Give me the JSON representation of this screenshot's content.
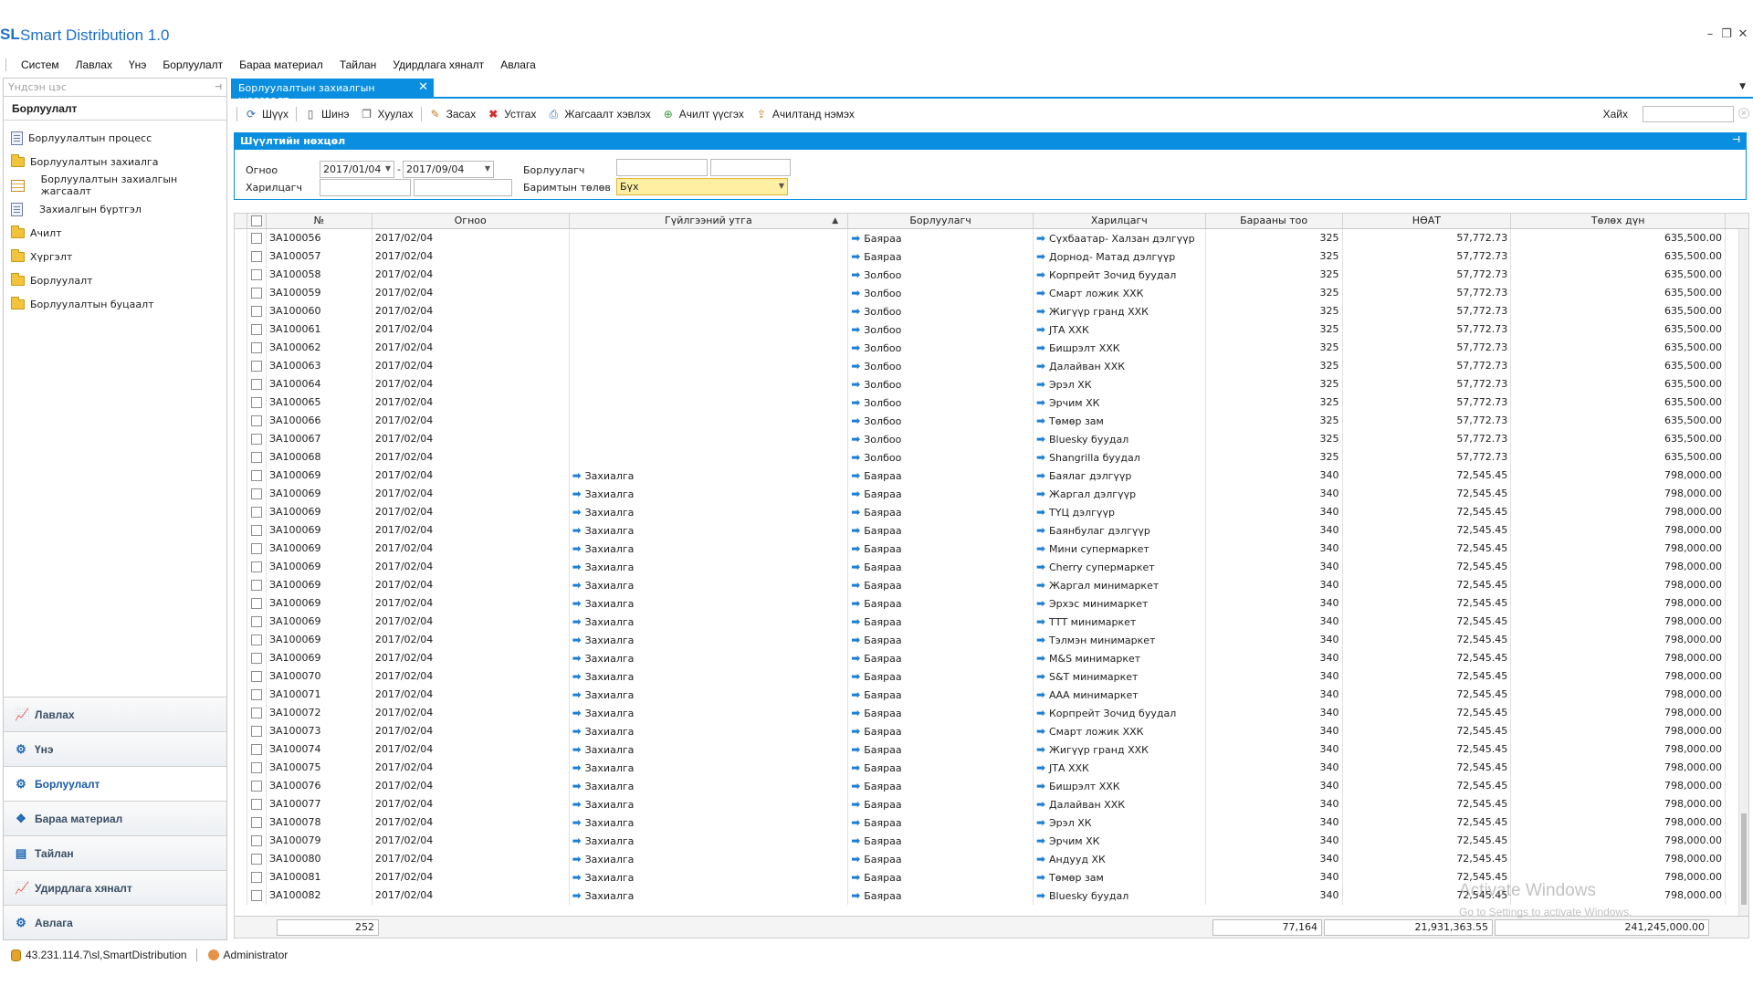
{
  "app": {
    "logo": "SL",
    "title": "Smart Distribution 1.0",
    "window_controls": [
      "–",
      "❐",
      "✕"
    ]
  },
  "menu": [
    "Систем",
    "Лавлах",
    "Үнэ",
    "Борлуулалт",
    "Бараа материал",
    "Тайлан",
    "Удирдлага хяналт",
    "Авлага"
  ],
  "sidebar": {
    "search_placeholder": "Үндсэн цэс",
    "header": "Борлуулалт",
    "tree": [
      {
        "label": "Борлуулалтын процесс",
        "icon": "document-icon"
      },
      {
        "label": "Борлуулалтын захиалга",
        "icon": "folder-icon"
      },
      {
        "label": "Борлуулалтын захиалгын жагсаалт",
        "icon": "grid-icon"
      },
      {
        "label": "Захиалгын бүртгэл",
        "icon": "document-icon"
      },
      {
        "label": "Ачилт",
        "icon": "folder-icon"
      },
      {
        "label": "Хүргэлт",
        "icon": "folder-icon"
      },
      {
        "label": "Борлуулалт",
        "icon": "folder-icon"
      },
      {
        "label": "Борлуулалтын буцаалт",
        "icon": "folder-icon"
      }
    ],
    "nav": [
      {
        "label": "Лавлах",
        "icon": "chart-icon"
      },
      {
        "label": "Үнэ",
        "icon": "gear-icon"
      },
      {
        "label": "Борлуулалт",
        "icon": "gear-icon"
      },
      {
        "label": "Бараа материал",
        "icon": "boxes-icon"
      },
      {
        "label": "Тайлан",
        "icon": "clipboard-icon"
      },
      {
        "label": "Удирдлага хяналт",
        "icon": "chart-icon"
      },
      {
        "label": "Авлага",
        "icon": "gear-icon"
      }
    ],
    "active_nav": "Борлуулалт"
  },
  "tab": {
    "label": "Борлуулалтын захиалгын жагсаалт",
    "close": "✕"
  },
  "toolbar": {
    "buttons": [
      {
        "label": "Шүүх",
        "icon": "filter-icon"
      },
      {
        "label": "Шинэ",
        "icon": "new-icon"
      },
      {
        "label": "Хуулах",
        "icon": "copy-icon"
      },
      {
        "label": "Засах",
        "icon": "edit-icon"
      },
      {
        "label": "Устгах",
        "icon": "delete-icon"
      },
      {
        "label": "Жагсаалт хэвлэх",
        "icon": "print-icon"
      },
      {
        "label": "Ачилт үүсгэх",
        "icon": "create-shipment-icon"
      },
      {
        "label": "Ачилтанд нэмэх",
        "icon": "add-to-shipment-icon"
      }
    ],
    "search_label": "Хайх",
    "search_value": ""
  },
  "filter": {
    "title": "Шүүлтийн нөхцөл",
    "date_label": "Огноо",
    "date_from": "2017/01/04",
    "date_sep": "-",
    "date_to": "2017/09/04",
    "seller_label": "Борлуулагч",
    "seller_value": "",
    "seller_value2": "",
    "customer_label": "Харилцагч",
    "customer_value": "",
    "customer_value2": "",
    "payment_label": "Баримтын төлөв",
    "payment_value": "Бүх"
  },
  "grid": {
    "columns": [
      "№",
      "Огноо",
      "Гүйлгээний утга",
      "Борлуулагч",
      "Харилцагч",
      "Барааны тоо",
      "НӨАТ",
      "Төлөх дүн"
    ],
    "rows": [
      [
        "ЗА100056",
        "2017/02/04",
        "",
        "Баяраа",
        "Сүхбаатар- Халзан дэлгүүр",
        "325",
        "57,772.73",
        "635,500.00"
      ],
      [
        "ЗА100057",
        "2017/02/04",
        "",
        "Баяраа",
        "Дорнод- Матад дэлгүүр",
        "325",
        "57,772.73",
        "635,500.00"
      ],
      [
        "ЗА100058",
        "2017/02/04",
        "",
        "Золбоо",
        "Корпрейт Зочид буудал",
        "325",
        "57,772.73",
        "635,500.00"
      ],
      [
        "ЗА100059",
        "2017/02/04",
        "",
        "Золбоо",
        "Смарт ложик ХХК",
        "325",
        "57,772.73",
        "635,500.00"
      ],
      [
        "ЗА100060",
        "2017/02/04",
        "",
        "Золбоо",
        "Жигүүр гранд ХХК",
        "325",
        "57,772.73",
        "635,500.00"
      ],
      [
        "ЗА100061",
        "2017/02/04",
        "",
        "Золбоо",
        "ЈТА ХХК",
        "325",
        "57,772.73",
        "635,500.00"
      ],
      [
        "ЗА100062",
        "2017/02/04",
        "",
        "Золбоо",
        "Бишрэлт ХХК",
        "325",
        "57,772.73",
        "635,500.00"
      ],
      [
        "ЗА100063",
        "2017/02/04",
        "",
        "Золбоо",
        "Далайван ХХК",
        "325",
        "57,772.73",
        "635,500.00"
      ],
      [
        "ЗА100064",
        "2017/02/04",
        "",
        "Золбоо",
        "Эрэл ХК",
        "325",
        "57,772.73",
        "635,500.00"
      ],
      [
        "ЗА100065",
        "2017/02/04",
        "",
        "Золбоо",
        "Эрчим ХК",
        "325",
        "57,772.73",
        "635,500.00"
      ],
      [
        "ЗА100066",
        "2017/02/04",
        "",
        "Золбоо",
        "Төмөр зам",
        "325",
        "57,772.73",
        "635,500.00"
      ],
      [
        "ЗА100067",
        "2017/02/04",
        "",
        "Золбоо",
        "Bluesky буудал",
        "325",
        "57,772.73",
        "635,500.00"
      ],
      [
        "ЗА100068",
        "2017/02/04",
        "",
        "Золбоо",
        "Shangrilla буудал",
        "325",
        "57,772.73",
        "635,500.00"
      ],
      [
        "ЗА100069",
        "2017/02/04",
        "Захиалга",
        "Баяраа",
        "Баялаг дэлгүүр",
        "340",
        "72,545.45",
        "798,000.00"
      ],
      [
        "ЗА100069",
        "2017/02/04",
        "Захиалга",
        "Баяраа",
        "Жаргал дэлгүүр",
        "340",
        "72,545.45",
        "798,000.00"
      ],
      [
        "ЗА100069",
        "2017/02/04",
        "Захиалга",
        "Баяраа",
        "ТҮЦ дэлгүүр",
        "340",
        "72,545.45",
        "798,000.00"
      ],
      [
        "ЗА100069",
        "2017/02/04",
        "Захиалга",
        "Баяраа",
        "Баянбулаг дэлгүүр",
        "340",
        "72,545.45",
        "798,000.00"
      ],
      [
        "ЗА100069",
        "2017/02/04",
        "Захиалга",
        "Баяраа",
        "Мини супермаркет",
        "340",
        "72,545.45",
        "798,000.00"
      ],
      [
        "ЗА100069",
        "2017/02/04",
        "Захиалга",
        "Баяраа",
        "Cherry супермаркет",
        "340",
        "72,545.45",
        "798,000.00"
      ],
      [
        "ЗА100069",
        "2017/02/04",
        "Захиалга",
        "Баяраа",
        "Жаргал минимаркет",
        "340",
        "72,545.45",
        "798,000.00"
      ],
      [
        "ЗА100069",
        "2017/02/04",
        "Захиалга",
        "Баяраа",
        "Эрхэс минимаркет",
        "340",
        "72,545.45",
        "798,000.00"
      ],
      [
        "ЗА100069",
        "2017/02/04",
        "Захиалга",
        "Баяраа",
        "ТТТ минимаркет",
        "340",
        "72,545.45",
        "798,000.00"
      ],
      [
        "ЗА100069",
        "2017/02/04",
        "Захиалга",
        "Баяраа",
        "Тэлмэн минимаркет",
        "340",
        "72,545.45",
        "798,000.00"
      ],
      [
        "ЗА100069",
        "2017/02/04",
        "Захиалга",
        "Баяраа",
        "M&S минимаркет",
        "340",
        "72,545.45",
        "798,000.00"
      ],
      [
        "ЗА100070",
        "2017/02/04",
        "Захиалга",
        "Баяраа",
        "S&T минимаркет",
        "340",
        "72,545.45",
        "798,000.00"
      ],
      [
        "ЗА100071",
        "2017/02/04",
        "Захиалга",
        "Баяраа",
        "ААА минимаркет",
        "340",
        "72,545.45",
        "798,000.00"
      ],
      [
        "ЗА100072",
        "2017/02/04",
        "Захиалга",
        "Баяраа",
        "Корпрейт Зочид буудал",
        "340",
        "72,545.45",
        "798,000.00"
      ],
      [
        "ЗА100073",
        "2017/02/04",
        "Захиалга",
        "Баяраа",
        "Смарт ложик ХХК",
        "340",
        "72,545.45",
        "798,000.00"
      ],
      [
        "ЗА100074",
        "2017/02/04",
        "Захиалга",
        "Баяраа",
        "Жигүүр гранд ХХК",
        "340",
        "72,545.45",
        "798,000.00"
      ],
      [
        "ЗА100075",
        "2017/02/04",
        "Захиалга",
        "Баяраа",
        "ЈТА ХХК",
        "340",
        "72,545.45",
        "798,000.00"
      ],
      [
        "ЗА100076",
        "2017/02/04",
        "Захиалга",
        "Баяраа",
        "Бишрэлт ХХК",
        "340",
        "72,545.45",
        "798,000.00"
      ],
      [
        "ЗА100077",
        "2017/02/04",
        "Захиалга",
        "Баяраа",
        "Далайван ХХК",
        "340",
        "72,545.45",
        "798,000.00"
      ],
      [
        "ЗА100078",
        "2017/02/04",
        "Захиалга",
        "Баяраа",
        "Эрэл ХК",
        "340",
        "72,545.45",
        "798,000.00"
      ],
      [
        "ЗА100079",
        "2017/02/04",
        "Захиалга",
        "Баяраа",
        "Эрчим ХК",
        "340",
        "72,545.45",
        "798,000.00"
      ],
      [
        "ЗА100080",
        "2017/02/04",
        "Захиалга",
        "Баяраа",
        "Андууд ХК",
        "340",
        "72,545.45",
        "798,000.00"
      ],
      [
        "ЗА100081",
        "2017/02/04",
        "Захиалга",
        "Баяраа",
        "Төмөр зам",
        "340",
        "72,545.45",
        "798,000.00"
      ],
      [
        "ЗА100082",
        "2017/02/04",
        "Захиалга",
        "Баяраа",
        "Bluesky буудал",
        "340",
        "72,545.45",
        "798,000.00"
      ]
    ],
    "footer": {
      "count": "252",
      "qty_total": "77,164",
      "vat_total": "21,931,363.55",
      "amount_total": "241,245,000.00"
    }
  },
  "watermark": {
    "line1": "Activate Windows",
    "line2": "Go to Settings to activate Windows."
  },
  "status": {
    "connection": "43.231.114.7\\sl,SmartDistribution",
    "user": "Administrator"
  },
  "colors": {
    "accent": "#0a8fe0",
    "brand": "#1b6fc8"
  }
}
